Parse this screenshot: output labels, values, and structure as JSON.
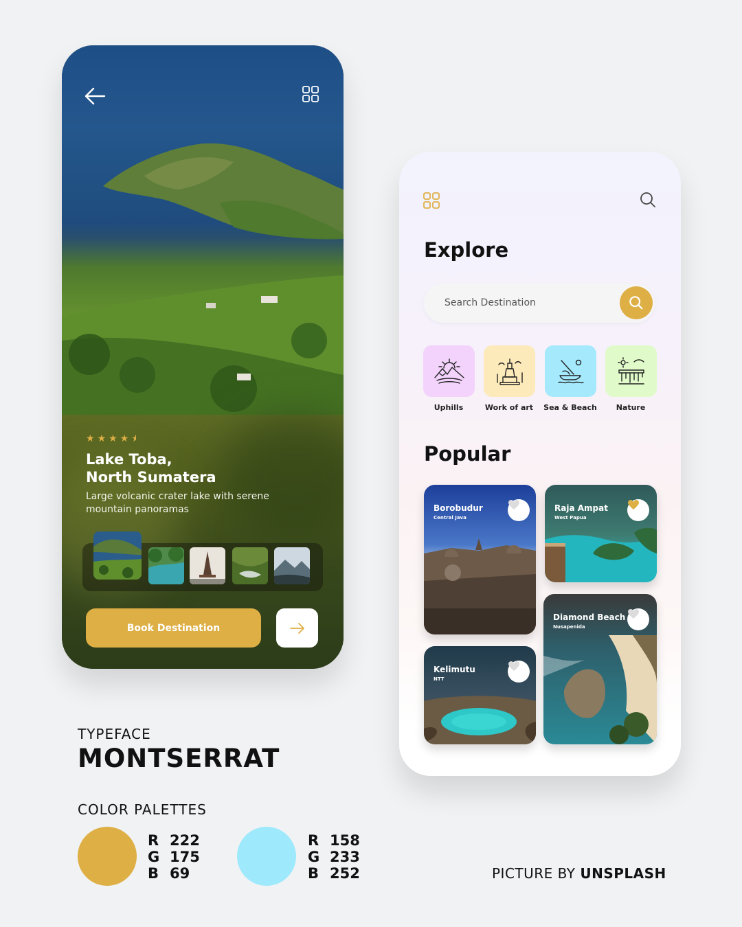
{
  "detail_screen": {
    "back_icon": "arrow-left-icon",
    "menu_icon": "grid-icon",
    "rating": 4.5,
    "title_line1": "Lake Toba,",
    "title_line2": "North Sumatera",
    "description": "Large volcanic crater lake with serene mountain panoramas",
    "book_label": "Book Destination",
    "next_icon": "arrow-right-icon"
  },
  "explore_screen": {
    "title": "Explore",
    "search_placeholder": "Search Destination",
    "categories": [
      {
        "label": "Uphills",
        "color": "#f3d3fb"
      },
      {
        "label": "Work of art",
        "color": "#fdeabb"
      },
      {
        "label": "Sea & Beach",
        "color": "#a5e9fc"
      },
      {
        "label": "Nature",
        "color": "#e0fbc9"
      }
    ],
    "popular_title": "Popular",
    "cards": [
      {
        "title": "Borobudur",
        "subtitle": "Central Java",
        "favorite": false
      },
      {
        "title": "Raja Ampat",
        "subtitle": "West Papua",
        "favorite": true
      },
      {
        "title": "Kelimutu",
        "subtitle": "NTT",
        "favorite": false
      },
      {
        "title": "Diamond Beach",
        "subtitle": "Nusapenida",
        "favorite": false
      }
    ]
  },
  "typography": {
    "label": "TYPEFACE",
    "name": "MONTSERRAT"
  },
  "palette": {
    "label": "COLOR PALETTES",
    "colors": [
      {
        "hex": "#deaf45",
        "r": "222",
        "g": "175",
        "b": "69"
      },
      {
        "hex": "#9ee9fc",
        "r": "158",
        "g": "233",
        "b": "252"
      }
    ],
    "r_key": "R",
    "g_key": "G",
    "b_key": "B"
  },
  "credit": {
    "prefix": "PICTURE BY ",
    "source": "UNSPLASH"
  },
  "colors": {
    "accent": "#deaf45",
    "accent_blue": "#9ee9fc",
    "background": "#f1f2f4"
  }
}
